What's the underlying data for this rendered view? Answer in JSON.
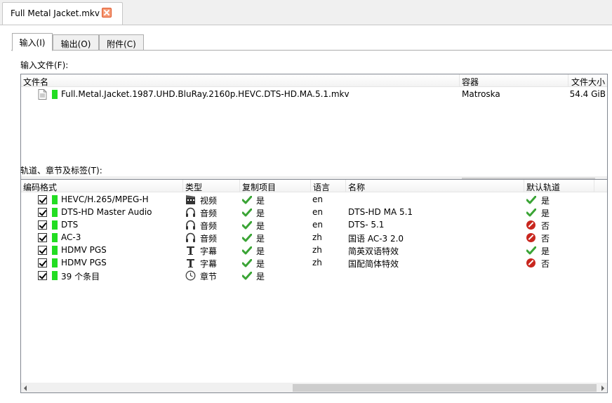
{
  "window": {
    "tab_title": "Full Metal Jacket.mkv"
  },
  "subtabs": [
    {
      "label": "输入(I)"
    },
    {
      "label": "输出(O)"
    },
    {
      "label": "附件(C)"
    }
  ],
  "input_files": {
    "section_label": "输入文件(F):",
    "columns": [
      "文件名",
      "容器",
      "文件大小"
    ],
    "rows": [
      {
        "name": "Full.Metal.Jacket.1987.UHD.BluRay.2160p.HEVC.DTS-HD.MA.5.1.mkv",
        "container": "Matroska",
        "size": "54.4 GiB"
      }
    ]
  },
  "tracks": {
    "section_label": "轨道、章节及标签(T):",
    "columns": [
      "编码格式",
      "类型",
      "复制项目",
      "语言",
      "名称",
      "默认轨道"
    ],
    "rows": [
      {
        "codec": "HEVC/H.265/MPEG-H",
        "type": "视频",
        "type_icon": "video-icon",
        "copy": "是",
        "lang": "en",
        "name": "",
        "default": "是",
        "default_ok": true
      },
      {
        "codec": "DTS-HD Master Audio",
        "type": "音频",
        "type_icon": "headphones-icon",
        "copy": "是",
        "lang": "en",
        "name": "DTS-HD MA 5.1",
        "default": "是",
        "default_ok": true
      },
      {
        "codec": "DTS",
        "type": "音频",
        "type_icon": "headphones-icon",
        "copy": "是",
        "lang": "en",
        "name": "DTS- 5.1",
        "default": "否",
        "default_ok": false
      },
      {
        "codec": "AC-3",
        "type": "音频",
        "type_icon": "headphones-icon",
        "copy": "是",
        "lang": "zh",
        "name": "国语 AC-3 2.0",
        "default": "否",
        "default_ok": false
      },
      {
        "codec": "HDMV PGS",
        "type": "字幕",
        "type_icon": "text-icon",
        "copy": "是",
        "lang": "zh",
        "name": "简英双语特效",
        "default": "是",
        "default_ok": true
      },
      {
        "codec": "HDMV PGS",
        "type": "字幕",
        "type_icon": "text-icon",
        "copy": "是",
        "lang": "zh",
        "name": "国配简体特效",
        "default": "否",
        "default_ok": false
      },
      {
        "codec": "39 个条目",
        "type": "章节",
        "type_icon": "clock-icon",
        "copy": "是",
        "lang": "",
        "name": "",
        "default": "",
        "default_ok": null
      }
    ]
  },
  "colors": {
    "track_indicator": "#22dd22",
    "check_green": "#3aa435",
    "no_red": "#c8261e"
  }
}
